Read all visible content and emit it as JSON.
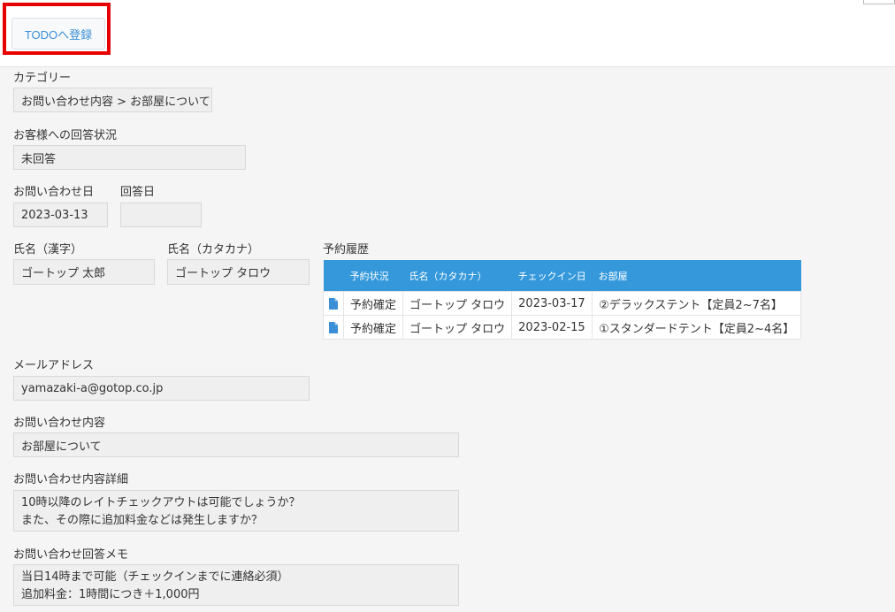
{
  "header": {
    "todo_button": "TODOへ登録"
  },
  "category": {
    "label": "カテゴリー",
    "value": "お問い合わせ内容 > お部屋について"
  },
  "reply_status": {
    "label": "お客様への回答状況",
    "value": "未回答"
  },
  "inquiry_date": {
    "label": "お問い合わせ日",
    "value": "2023-03-13"
  },
  "reply_date": {
    "label": "回答日",
    "value": ""
  },
  "name_kanji": {
    "label": "氏名（漢字）",
    "value": "ゴートップ 太郎"
  },
  "name_kana": {
    "label": "氏名（カタカナ）",
    "value": "ゴートップ タロウ"
  },
  "reservations": {
    "label": "予約履歴",
    "headers": [
      "予約状況",
      "氏名（カタカナ）",
      "チェックイン日",
      "お部屋"
    ],
    "rows": [
      {
        "status": "予約確定",
        "name": "ゴートップ タロウ",
        "checkin": "2023-03-17",
        "room": "②デラックステント【定員2~7名】"
      },
      {
        "status": "予約確定",
        "name": "ゴートップ タロウ",
        "checkin": "2023-02-15",
        "room": "①スタンダードテント【定員2~4名】"
      }
    ]
  },
  "email": {
    "label": "メールアドレス",
    "value": "yamazaki-a@gotop.co.jp"
  },
  "inquiry_content": {
    "label": "お問い合わせ内容",
    "value": "お部屋について"
  },
  "inquiry_detail": {
    "label": "お問い合わせ内容詳細",
    "lines": [
      "10時以降のレイトチェックアウトは可能でしょうか？",
      "また、その際に追加料金などは発生しますか？"
    ]
  },
  "reply_memo": {
    "label": "お問い合わせ回答メモ",
    "lines": [
      "当日14時まで可能（チェックインまでに連絡必須）",
      "追加料金：1時間につき＋1,000円"
    ]
  },
  "colors": {
    "table_header": "#3498db",
    "highlight": "#e60000",
    "button_text": "#3a8fd6"
  },
  "icons": {
    "row_icon": "document-icon"
  }
}
